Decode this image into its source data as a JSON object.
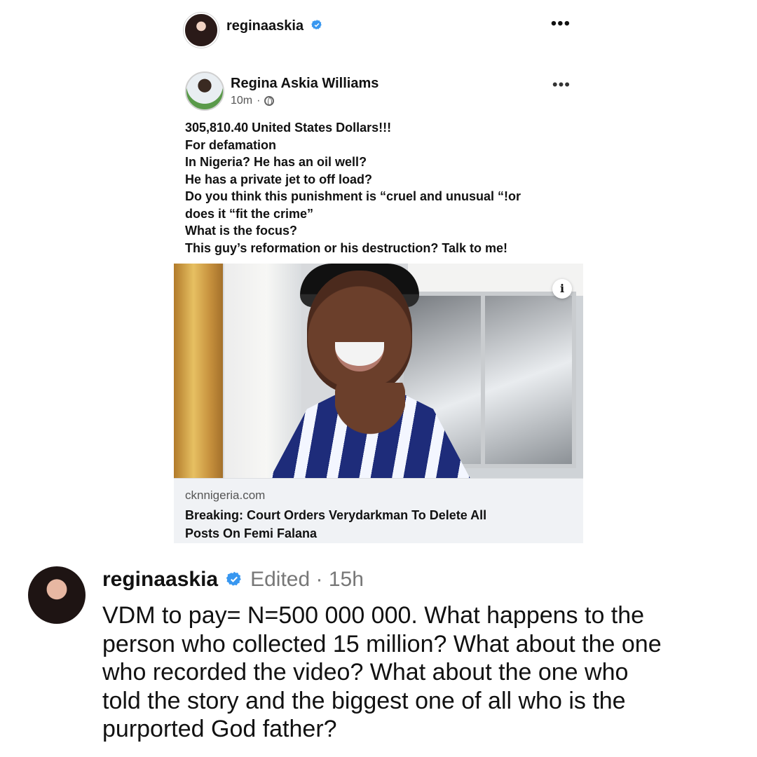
{
  "instagram": {
    "username": "reginaaskia",
    "more_label": "•••"
  },
  "facebook_post": {
    "author": "Regina Askia Williams",
    "time": "10m",
    "time_separator": "·",
    "more_label": "•••",
    "lines": [
      "305,810.40 United States Dollars!!!",
      "For defamation",
      "In Nigeria? He has an oil well?",
      "He has a private jet to off load?",
      "Do you think this  punishment is “cruel and unusual “!or",
      "does it “fit the crime”",
      "What is the focus?",
      "This guy’s reformation or his destruction? Talk to me!"
    ]
  },
  "link_preview": {
    "info_label": "i",
    "domain": "cknnigeria.com",
    "title_lines": [
      "Breaking: Court Orders Verydarkman To Delete All",
      "Posts On Femi Falana"
    ]
  },
  "comment": {
    "username": "reginaaskia",
    "meta": "Edited · 15h",
    "lines": [
      "VDM to pay= N=500 000 000. What happens to the",
      "person who collected 15 million? What about the one",
      "who recorded the video? What about the one who",
      "told the story and the biggest one of all who is the",
      "purported God father?"
    ]
  },
  "colors": {
    "verified": "#3897f0",
    "text_primary": "#111111",
    "text_secondary": "#555555",
    "link_bg": "#f0f2f5"
  },
  "icons": {
    "verified": "verified-badge-icon",
    "globe": "globe-icon",
    "more": "more-icon",
    "info": "info-icon"
  }
}
